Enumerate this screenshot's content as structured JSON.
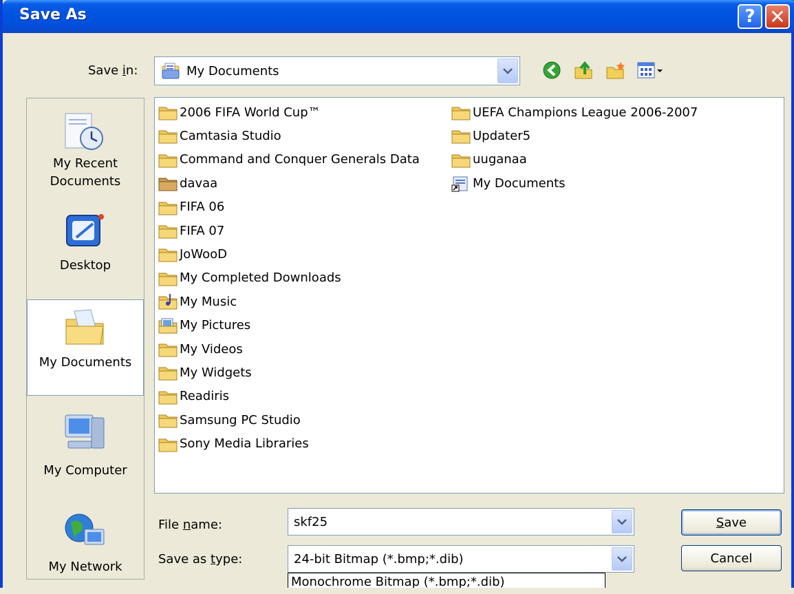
{
  "window": {
    "title": "Save As"
  },
  "titlebar": {
    "help_glyph": "?",
    "close_glyph": "✕"
  },
  "save_in": {
    "label_pre": "Save ",
    "label_u": "i",
    "label_post": "n:",
    "value": "My Documents"
  },
  "toolbar": {
    "icons": [
      "back-icon",
      "up-folder-icon",
      "new-folder-icon",
      "view-menu-icon"
    ]
  },
  "places": [
    {
      "label_lines": [
        "My Recent",
        "Documents"
      ],
      "icon": "recent-documents-icon"
    },
    {
      "label_lines": [
        "Desktop"
      ],
      "icon": "desktop-icon"
    },
    {
      "label_lines": [
        "My Documents"
      ],
      "icon": "my-documents-icon"
    },
    {
      "label_lines": [
        "My Computer"
      ],
      "icon": "my-computer-icon"
    },
    {
      "label_lines": [
        "My Network"
      ],
      "icon": "my-network-icon"
    }
  ],
  "files": {
    "col1": [
      "2006 FIFA World Cup™",
      "Camtasia Studio",
      "Command and Conquer Generals Data",
      "davaa",
      "FIFA 06",
      "FIFA 07",
      "JoWooD",
      "My Completed Downloads",
      "My Music",
      "My Pictures",
      "My Videos",
      "My Widgets",
      "Readiris",
      "Samsung PC Studio",
      "Sony Media Libraries"
    ],
    "col2": [
      "UEFA Champions League 2006-2007",
      "Updater5",
      "uuganaa",
      "My Documents"
    ]
  },
  "filename": {
    "label_pre": "File ",
    "label_u": "n",
    "label_post": "ame:",
    "value": "skf25"
  },
  "savetype": {
    "label_pre": "Save as ",
    "label_u": "t",
    "label_post": "ype:",
    "value": "24-bit Bitmap (*.bmp;*.dib)",
    "next_option": "Monochrome Bitmap (*.bmp;*.dib)"
  },
  "buttons": {
    "save_u": "S",
    "save_rest": "ave",
    "cancel": "Cancel"
  }
}
